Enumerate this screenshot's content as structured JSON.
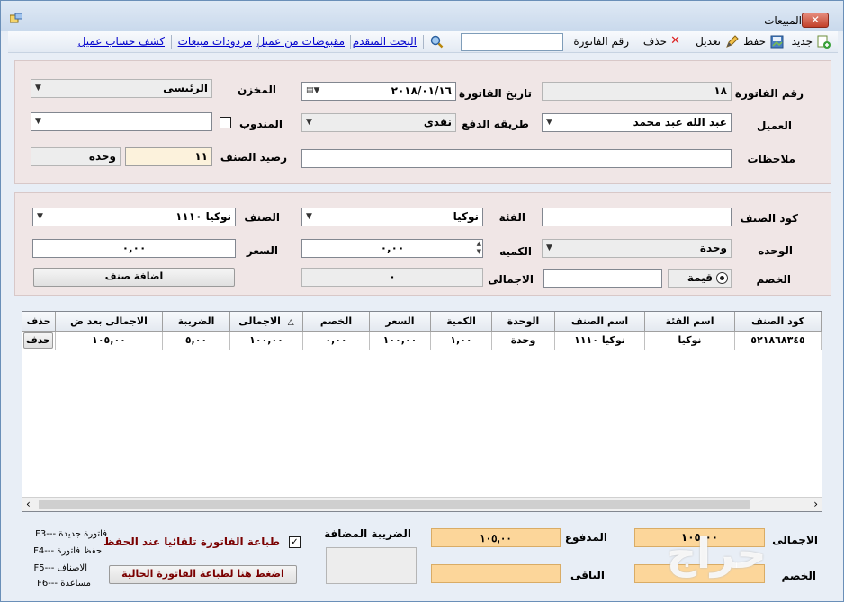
{
  "window": {
    "title": "المبيعات",
    "close_label": "✕"
  },
  "toolbar": {
    "new_label": "جديد",
    "save_label": "حفظ",
    "edit_label": "تعديل",
    "delete_label": "حذف",
    "invoice_no_label": "رقم الفاتورة",
    "invoice_no_value": "",
    "advanced_search": "البحث المتقدم",
    "customer_receipts": "مقبوضات من عميل",
    "sales_returns": "مردودات مبيعات",
    "customer_statement": "كشف حساب عميل"
  },
  "header": {
    "invoice_no_label": "رقم الفاتورة",
    "invoice_no_value": "١٨",
    "invoice_date_label": "تاريخ الفاتورة",
    "invoice_date_value": "٢٠١٨/٠١/١٦",
    "store_label": "المخزن",
    "store_value": "الرئيسى",
    "customer_label": "العميل",
    "customer_value": "عبد الله عبد محمد",
    "payment_label": "طريقه الدفع",
    "payment_value": "نقدى",
    "rep_label": "المندوب",
    "rep_value": "",
    "notes_label": "ملاحظات",
    "notes_value": "",
    "item_balance_label": "رصيد الصنف",
    "item_balance_value": "١١",
    "item_balance_unit": "وحدة"
  },
  "item": {
    "code_label": "كود الصنف",
    "code_value": "",
    "category_label": "الفئة",
    "category_value": "نوكيا",
    "item_label": "الصنف",
    "item_value": "نوكيا ١١١٠",
    "unit_label": "الوحده",
    "unit_value": "وحدة",
    "qty_label": "الكميه",
    "qty_value": "٠,٠٠",
    "price_label": "السعر",
    "price_value": "٠,٠٠",
    "discount_label": "الخصم",
    "discount_type": "قيمة",
    "discount_value": "",
    "total_label": "الاجمالى",
    "total_value": "٠",
    "add_button": "اضافة صنف"
  },
  "grid": {
    "columns": [
      "كود الصنف",
      "اسم الفئة",
      "اسم الصنف",
      "الوحدة",
      "الكمية",
      "السعر",
      "الخصم",
      "الاجمالى",
      "الضريبة",
      "الاجمالى بعد ض",
      "حذف"
    ],
    "sort_indicator": "△",
    "rows": [
      [
        "٥٢١٨٦٨٣٤٥",
        "نوكيا",
        "نوكيا ١١١٠",
        "وحدة",
        "١,٠٠",
        "١٠٠,٠٠",
        "٠,٠٠",
        "١٠٠,٠٠",
        "٥,٠٠",
        "١٠٥,٠٠",
        "حذف"
      ]
    ],
    "scroll_left": "‹",
    "scroll_right": "›"
  },
  "footer": {
    "total_label": "الاجمالى",
    "total_value": "١٠٥,٠٠",
    "discount_label": "الخصم",
    "discount_value": "",
    "paid_label": "المدفوع",
    "paid_value": "١٠٥,٠٠",
    "remaining_label": "الباقى",
    "remaining_value": "",
    "vat_label": "الضريبة المضافة",
    "auto_print_label": "طباعة الفاتورة تلقائيا عند الحفظ",
    "auto_print_checked": "✓",
    "print_button": "اضغط هنا لطباعة الفاتورة الحالية",
    "shortcuts": [
      "فاتورة جديدة ---F3",
      "حفظ فاتورة ---F4",
      "الاصناف ---F5",
      "مساعدة ---F6"
    ],
    "watermark": "حراج"
  }
}
